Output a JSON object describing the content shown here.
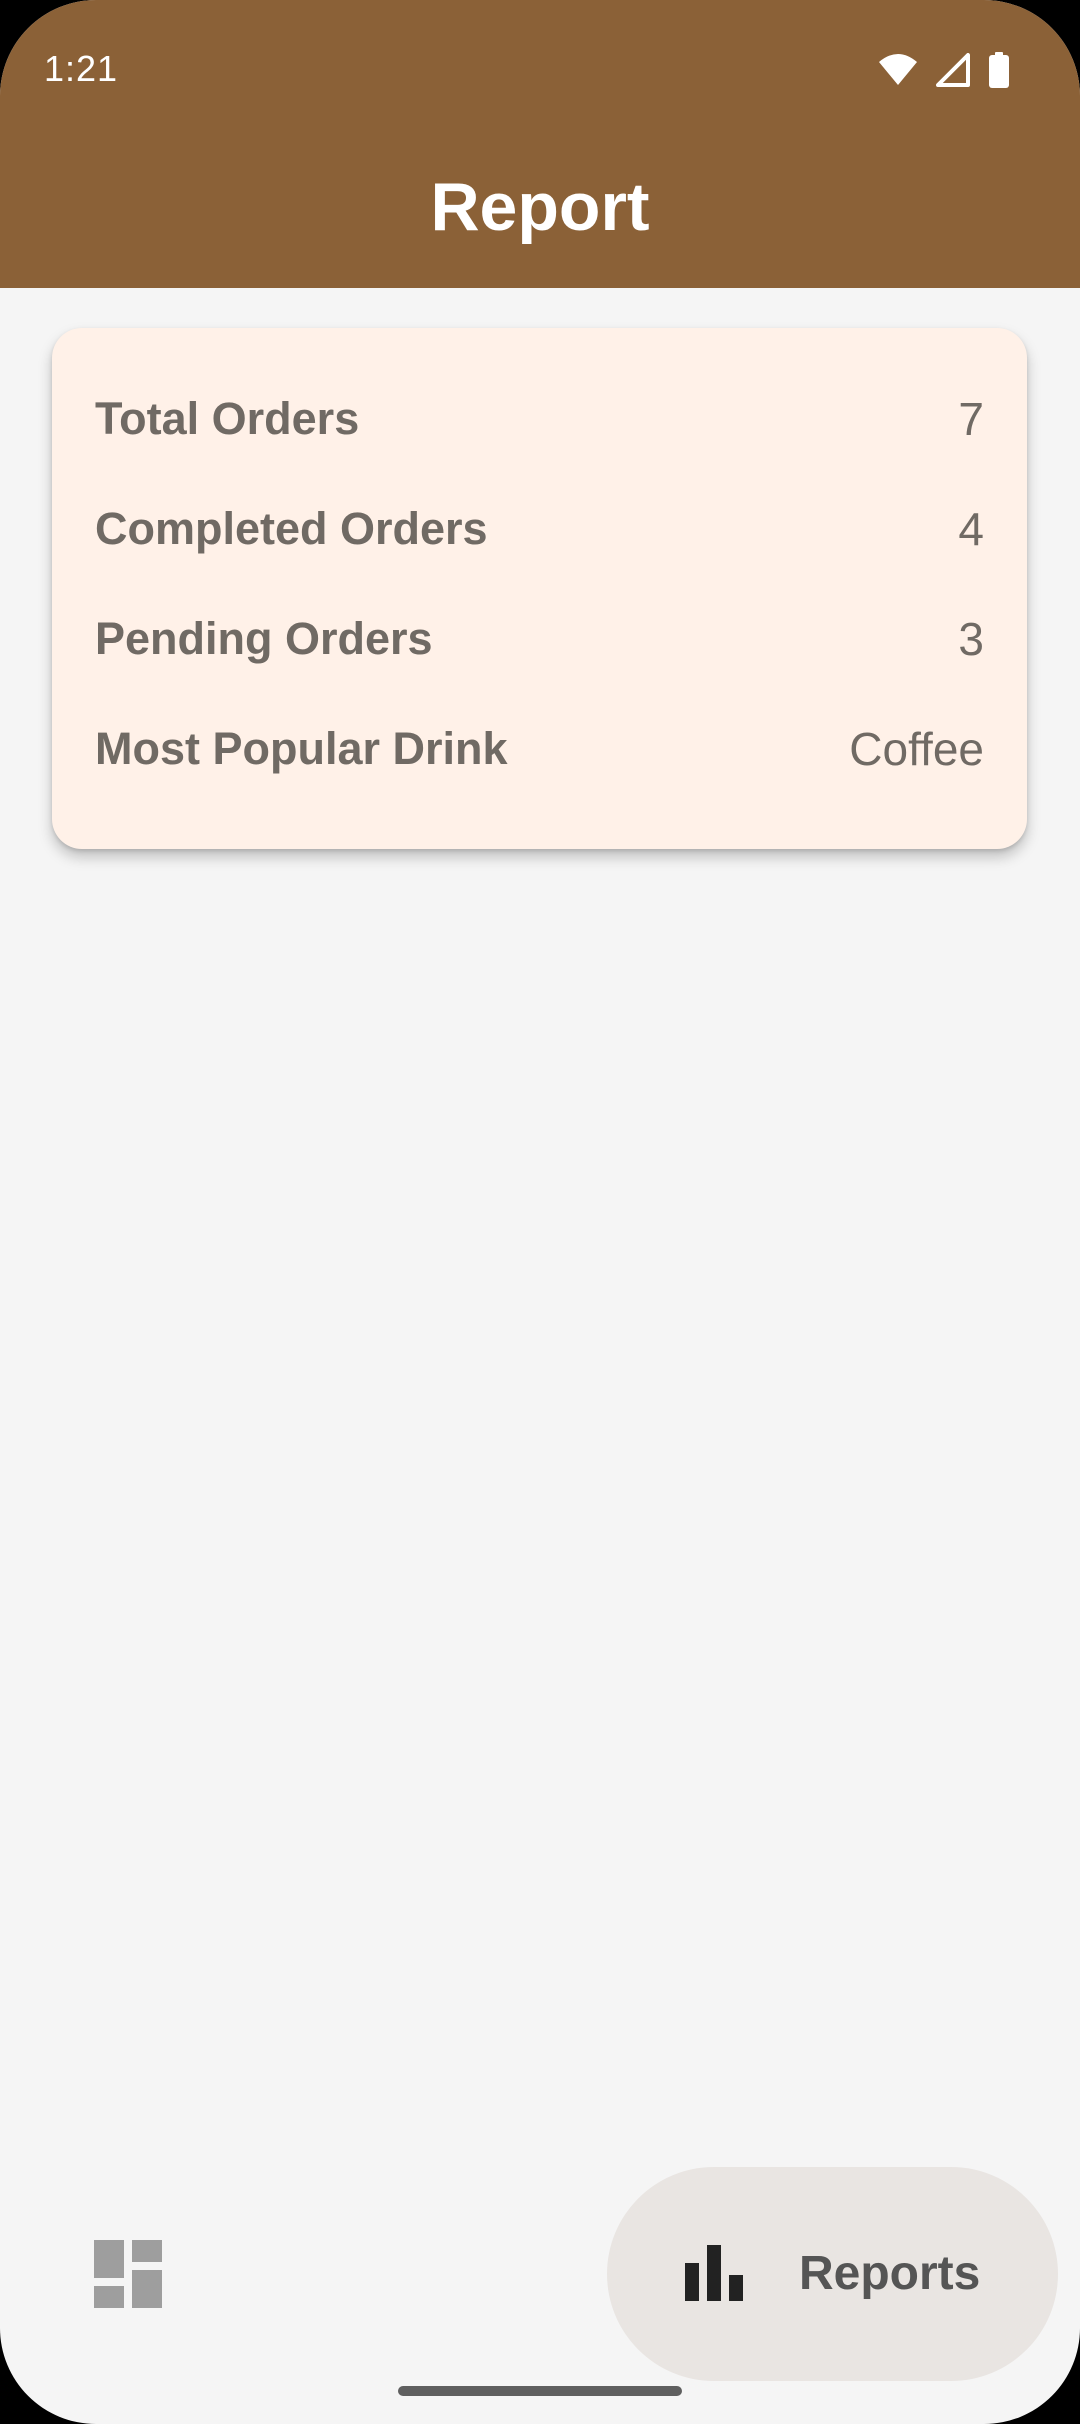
{
  "status_bar": {
    "time": "1:21",
    "icons": [
      "wifi-icon",
      "cellular-signal-icon",
      "battery-icon"
    ]
  },
  "header": {
    "title": "Report"
  },
  "summary": {
    "rows": [
      {
        "label": "Total Orders",
        "value": "7"
      },
      {
        "label": "Completed Orders",
        "value": "4"
      },
      {
        "label": "Pending Orders",
        "value": "3"
      },
      {
        "label": "Most Popular Drink",
        "value": "Coffee"
      }
    ]
  },
  "bottom_nav": {
    "items": [
      {
        "icon": "dashboard-icon",
        "label": "",
        "selected": false
      },
      {
        "icon": "bar-chart-icon",
        "label": "Reports",
        "selected": true
      }
    ]
  },
  "colors": {
    "header": "#8b6137",
    "background": "#f5f5f5",
    "card": "#fff1e8",
    "text": "#706a64",
    "nav_selected": "#e9e5e2"
  }
}
